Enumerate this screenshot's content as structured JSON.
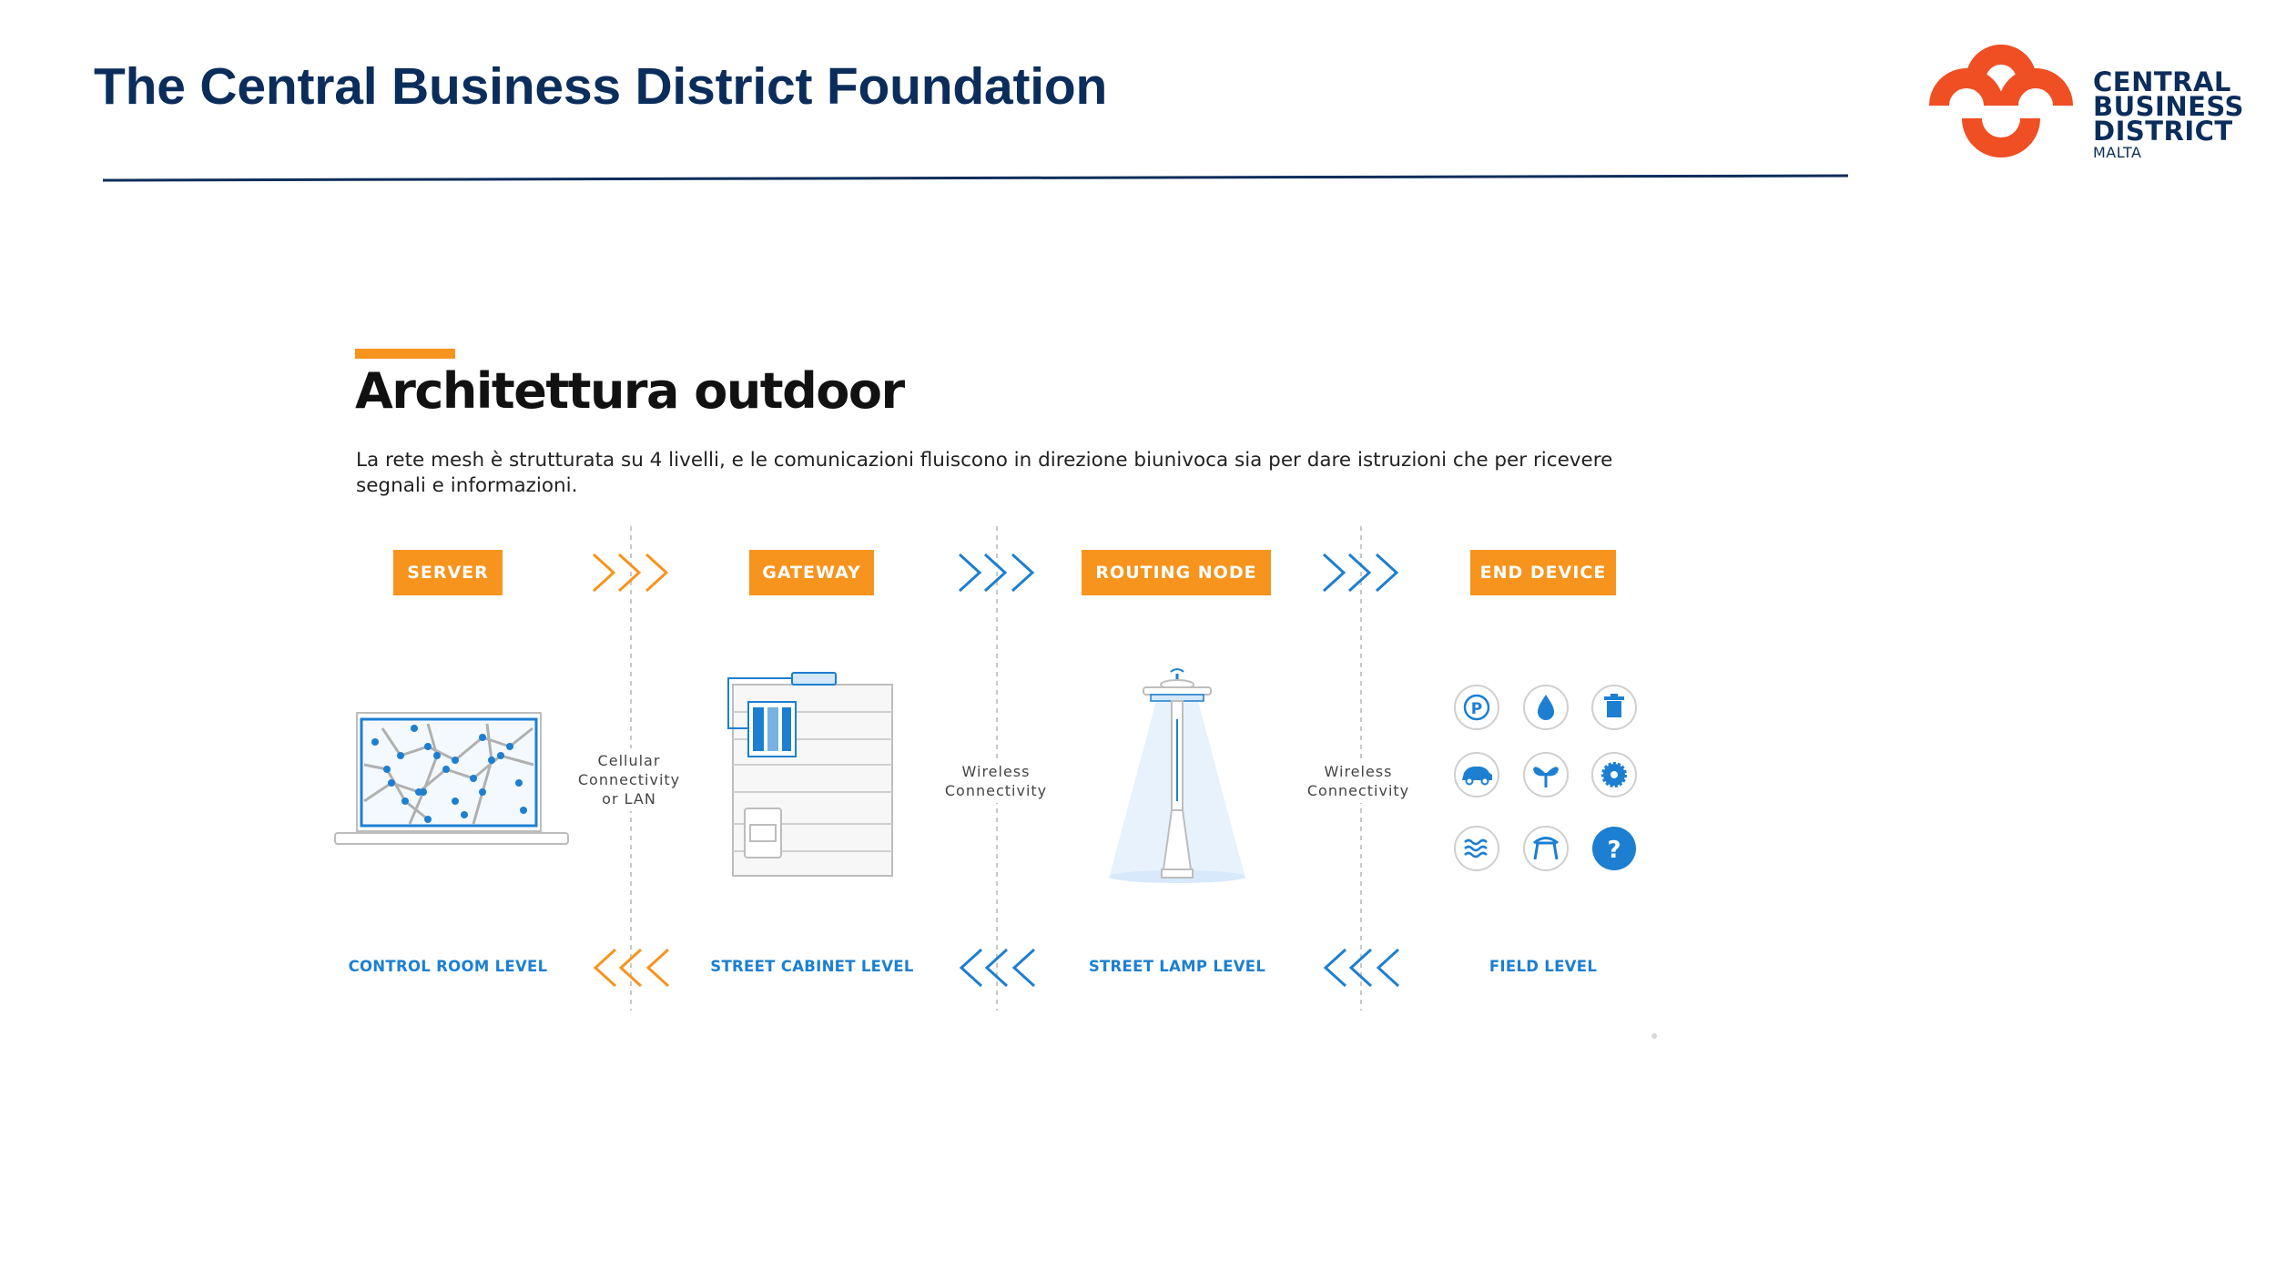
{
  "header": {
    "title": "The Central Business District Foundation"
  },
  "logo": {
    "line1": "CENTRAL",
    "line2": "BUSINESS",
    "line3": "DISTRICT",
    "line4": "MALTA"
  },
  "colors": {
    "navy": "#0b2d5b",
    "orange": "#f7941d",
    "logo_red": "#f04e23",
    "blue": "#1c7fd1"
  },
  "diagram": {
    "title": "Architettura outdoor",
    "intro": "La rete mesh è strutturata su 4 livelli, e le comunicazioni fluiscono in direzione biunivoca sia per dare istruzioni che per ricevere segnali e informazioni.",
    "stages": [
      {
        "label": "SERVER",
        "level": "CONTROL ROOM LEVEL"
      },
      {
        "label": "GATEWAY",
        "level": "STREET CABINET LEVEL"
      },
      {
        "label": "ROUTING NODE",
        "level": "STREET LAMP LEVEL"
      },
      {
        "label": "END DEVICE",
        "level": "FIELD LEVEL"
      }
    ],
    "connections": [
      {
        "line1": "Cellular",
        "line2": "Connectivity",
        "line3": "or LAN"
      },
      {
        "line1": "Wireless",
        "line2": "Connectivity"
      },
      {
        "line1": "Wireless",
        "line2": "Connectivity"
      }
    ],
    "devices": [
      {
        "icon": "parking-icon",
        "text": "P"
      },
      {
        "icon": "water-drop-icon"
      },
      {
        "icon": "trash-bin-icon"
      },
      {
        "icon": "car-icon"
      },
      {
        "icon": "plant-icon"
      },
      {
        "icon": "gear-sensor-icon"
      },
      {
        "icon": "waves-icon"
      },
      {
        "icon": "bench-icon"
      },
      {
        "icon": "question-icon",
        "text": "?"
      }
    ]
  }
}
